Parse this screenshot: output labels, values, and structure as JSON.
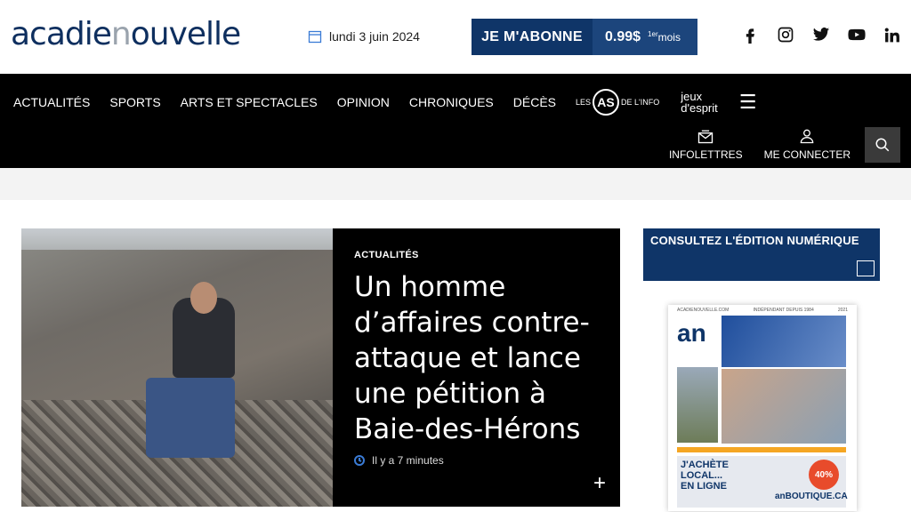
{
  "header": {
    "logo_part1": "acadie",
    "logo_part2": "n",
    "logo_part3": "ouvelle",
    "date": "lundi 3 juin 2024",
    "subscribe_label": "JE M'ABONNE",
    "price": "0.99$",
    "price_period_sup": "1er",
    "price_period": "mois",
    "social_icons": [
      "facebook-icon",
      "instagram-icon",
      "twitter-icon",
      "youtube-icon",
      "linkedin-icon"
    ]
  },
  "nav": {
    "items": [
      "ACTUALITÉS",
      "SPORTS",
      "ARTS ET SPECTACLES",
      "OPINION",
      "CHRONIQUES",
      "DÉCÈS"
    ],
    "as_brand_left": "LES",
    "as_brand_badge": "AS",
    "as_brand_right": "DE L'INFO",
    "jeux_line1": "jeux",
    "jeux_line2": "d'esprit",
    "newsletters_label": "INFOLETTRES",
    "login_label": "ME CONNECTER"
  },
  "hero": {
    "category": "ACTUALITÉS",
    "title": "Un homme d’affaires contre-attaque et lance une pétition à Baie-des-Hérons",
    "time": "Il y a 7 minutes",
    "more": "+"
  },
  "edition": {
    "title": "CONSULTEZ L'ÉDITION NUMÉRIQUE",
    "paper_head_left": "ACADIENOUVELLE.COM",
    "paper_head_mid": "INDÉPENDANT DEPUIS 1984",
    "paper_head_right": "2021",
    "paper_logo": "an",
    "ad_line1": "J'ACHÈTE",
    "ad_line2": "LOCAL...",
    "ad_line3": "EN LIGNE",
    "ad_badge": "40%",
    "ad_shop": "anBOUTIQUE.CA"
  },
  "colors": {
    "brand_blue": "#0f3568",
    "nav_bg": "#000000",
    "band_gray": "#f3f3f3"
  }
}
